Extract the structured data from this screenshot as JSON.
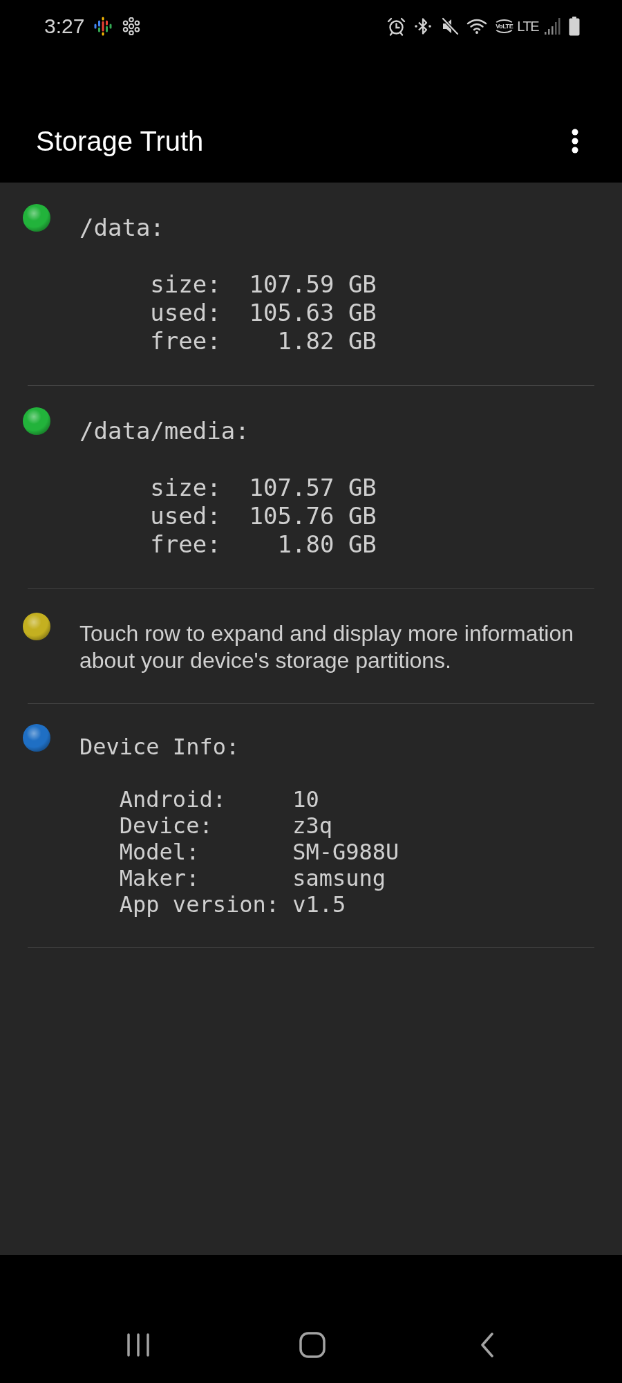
{
  "status_bar": {
    "time": "3:27",
    "volte_label": "VoLTE",
    "network_type": "LTE"
  },
  "app_bar": {
    "title": "Storage Truth"
  },
  "rows": [
    {
      "kind": "partition",
      "color": "#22b33b",
      "title": "/data:",
      "stats": [
        {
          "label": "size:",
          "value": "107.59 GB"
        },
        {
          "label": "used:",
          "value": "105.63 GB"
        },
        {
          "label": "free:",
          "value": "1.82 GB"
        }
      ]
    },
    {
      "kind": "partition",
      "color": "#22b33b",
      "title": "/data/media:",
      "stats": [
        {
          "label": "size:",
          "value": "107.57 GB"
        },
        {
          "label": "used:",
          "value": "105.76 GB"
        },
        {
          "label": "free:",
          "value": "1.80 GB"
        }
      ]
    },
    {
      "kind": "hint",
      "color": "#c4b020",
      "text": "Touch row to expand and display more information about your device's storage partitions."
    },
    {
      "kind": "device_info",
      "color": "#1f6fc4",
      "title": "Device Info:",
      "fields": [
        {
          "label": "Android:",
          "value": "10"
        },
        {
          "label": "Device:",
          "value": "z3q"
        },
        {
          "label": "Model:",
          "value": "SM-G988U"
        },
        {
          "label": "Maker:",
          "value": "samsung"
        },
        {
          "label": "App version:",
          "value": "v1.5"
        }
      ]
    }
  ]
}
